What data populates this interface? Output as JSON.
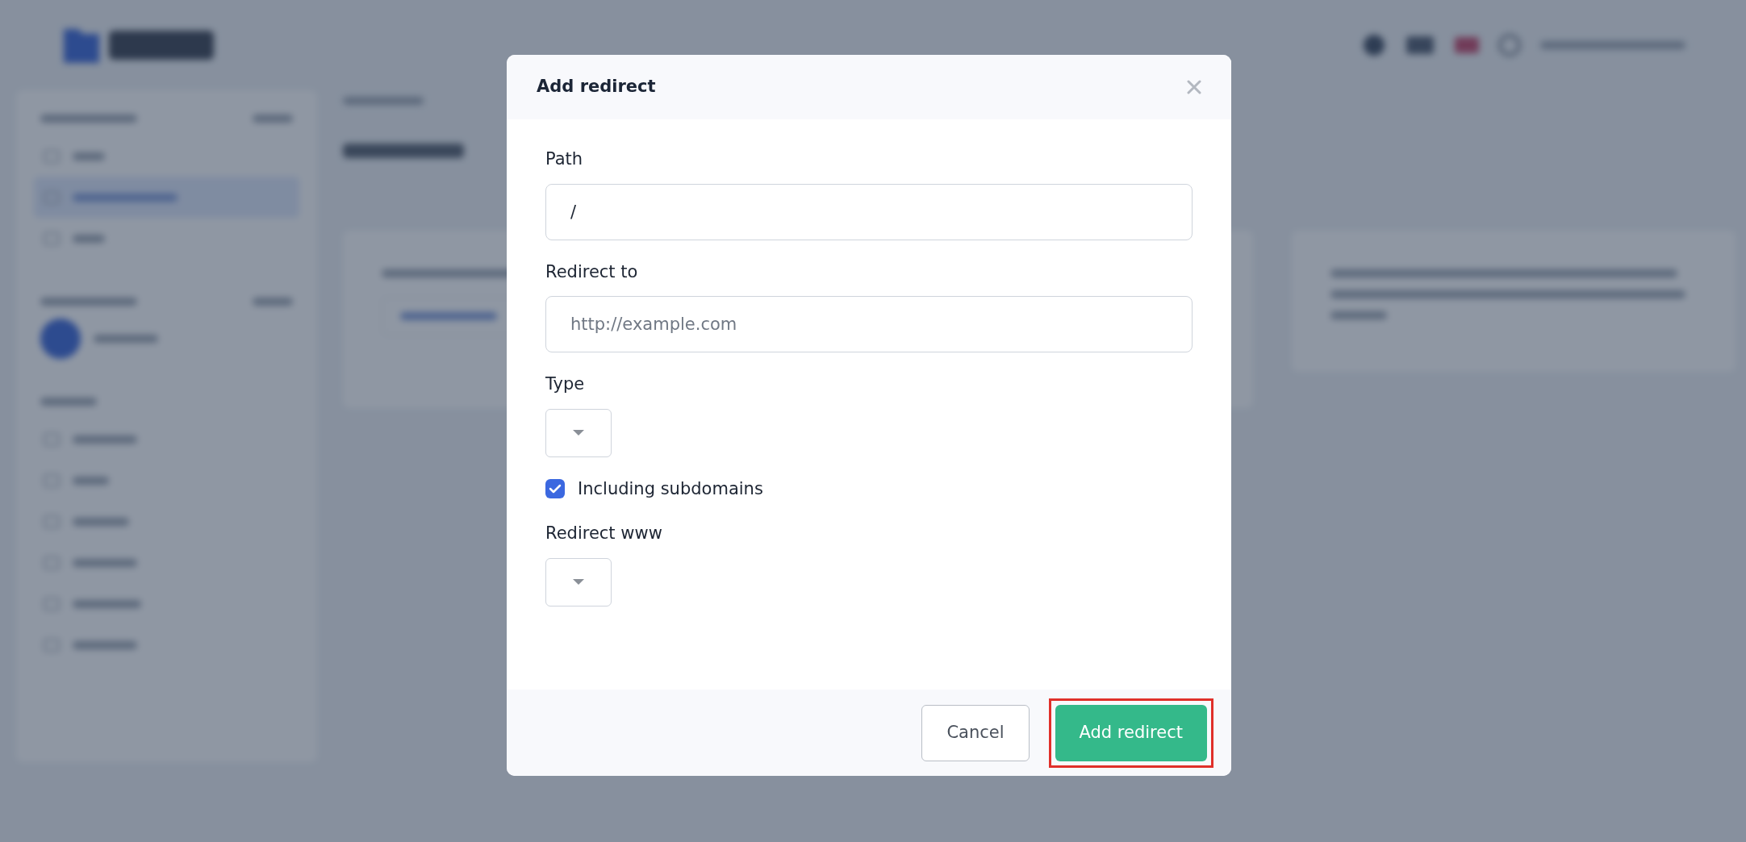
{
  "sidebar": {
    "items": [
      {
        "selected": false
      },
      {
        "selected": true
      },
      {
        "selected": false
      },
      {
        "selected": false
      },
      {
        "selected": false
      },
      {
        "selected": false
      },
      {
        "selected": false
      },
      {
        "selected": false
      },
      {
        "selected": false
      }
    ]
  },
  "modal": {
    "title": "Add redirect",
    "fields": [
      {
        "kind": "text",
        "label": "Path",
        "value": "/"
      },
      {
        "kind": "text",
        "label": "Redirect to",
        "placeholder": "http://example.com"
      },
      {
        "kind": "select",
        "label": "Type"
      },
      {
        "kind": "checkbox",
        "label": "Including subdomains",
        "checked": true
      },
      {
        "kind": "select",
        "label": "Redirect www"
      }
    ],
    "buttons": [
      {
        "kind": "secondary",
        "label": "Cancel",
        "highlighted": false
      },
      {
        "kind": "primary",
        "label": "Add redirect",
        "highlighted": true
      }
    ]
  }
}
